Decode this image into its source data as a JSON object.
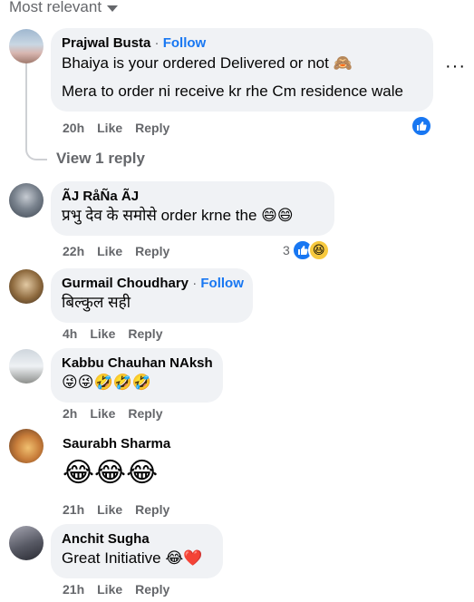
{
  "sort": {
    "label": "Most relevant"
  },
  "comments": [
    {
      "name": "Prajwal Busta",
      "follow": "Follow",
      "lines": [
        "Bhaiya is your ordered Delivered or not 🙈",
        "Mera to order ni receive kr rhe Cm residence wale"
      ],
      "time": "20h",
      "like": "Like",
      "reply": "Reply"
    },
    {
      "name": "ÃJ RåÑa ÃJ",
      "text": "प्रभु देव के समोसे order krne the 😄😄",
      "time": "22h",
      "like": "Like",
      "reply": "Reply",
      "reaction_count": "3"
    },
    {
      "name": "Gurmail Choudhary",
      "follow": "Follow",
      "text": "बिल्कुल सही",
      "time": "4h",
      "like": "Like",
      "reply": "Reply"
    },
    {
      "name": "Kabbu Chauhan NAksh",
      "text": "😜😜🤣🤣🤣",
      "time": "2h",
      "like": "Like",
      "reply": "Reply"
    },
    {
      "name": "Saurabh Sharma",
      "text": "😂😂😂",
      "time": "21h",
      "like": "Like",
      "reply": "Reply"
    },
    {
      "name": "Anchit Sugha",
      "text": "Great Initiative 😂❤️",
      "time": "21h",
      "like": "Like",
      "reply": "Reply"
    }
  ],
  "view_reply": "View 1 reply",
  "more_dots": "···",
  "icons": {
    "like": "thumbs-up-icon",
    "haha": "laughing-face-icon",
    "sort": "chevron-down-icon",
    "more": "more-horizontal-icon"
  },
  "colors": {
    "link": "#1877f2",
    "bubble": "#f0f2f5",
    "muted": "#65676b"
  }
}
